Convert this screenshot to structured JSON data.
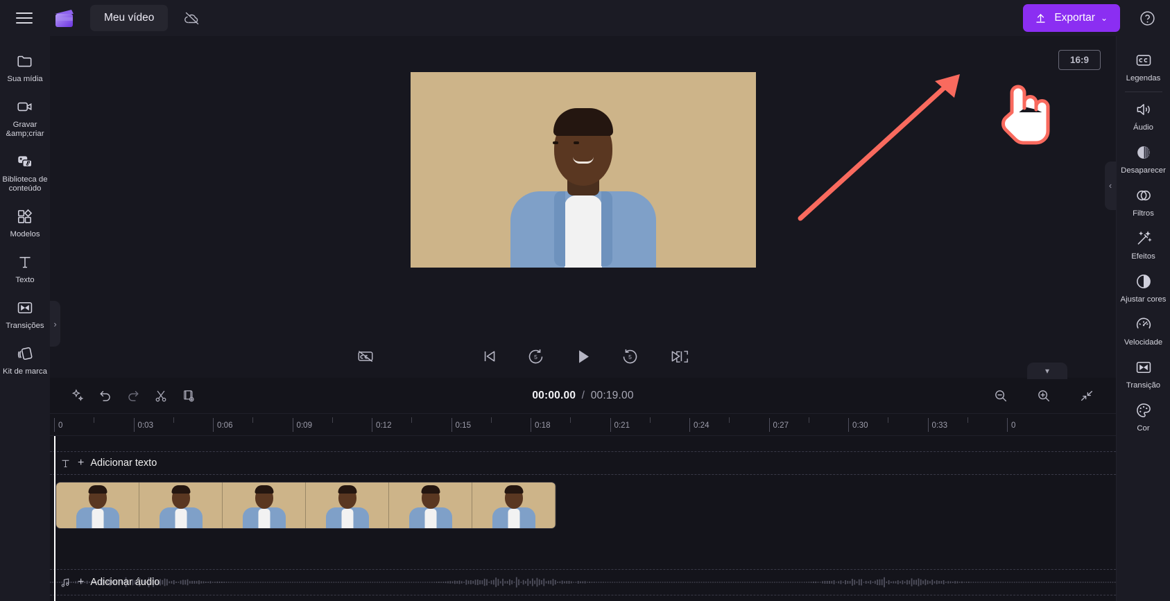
{
  "topbar": {
    "menu_icon": "hamburger-icon",
    "logo_icon": "clapperboard-logo",
    "project_name": "Meu vídeo",
    "cloud_status_icon": "cloud-off-icon",
    "export_label": "Exportar",
    "export_icon": "upload-icon",
    "export_caret": "⌄",
    "help_icon": "help-circle-icon",
    "accent_color": "#8b2ef2"
  },
  "left_rail": {
    "items": [
      {
        "label": "Sua mídia",
        "icon": "folder-icon"
      },
      {
        "label": "Gravar &amp;criar",
        "icon": "video-camera-icon"
      },
      {
        "label": "Biblioteca de conteúdo",
        "icon": "content-library-icon"
      },
      {
        "label": "Modelos",
        "icon": "templates-icon"
      },
      {
        "label": "Texto",
        "icon": "text-t-icon"
      },
      {
        "label": "Transições",
        "icon": "transitions-icon"
      },
      {
        "label": "Kit de marca",
        "icon": "brand-kit-icon"
      }
    ]
  },
  "preview": {
    "aspect_ratio": "16:9",
    "collapse_left_icon": "chevron-right-icon",
    "collapse_right_icon": "chevron-left-icon"
  },
  "player": {
    "cc_icon": "captions-off-icon",
    "skip_start_icon": "skip-to-start-icon",
    "back5_icon": "rewind-5-icon",
    "back5_label": "5",
    "play_icon": "play-icon",
    "fwd5_icon": "forward-5-icon",
    "fwd5_label": "5",
    "skip_end_icon": "skip-to-end-icon",
    "fullscreen_icon": "fullscreen-icon"
  },
  "timeline": {
    "collapse_icon": "chevron-down-icon",
    "tools": [
      {
        "icon": "magic-wand-icon",
        "name": "auto-compose"
      },
      {
        "icon": "undo-icon",
        "name": "undo"
      },
      {
        "icon": "redo-icon",
        "name": "redo"
      },
      {
        "icon": "scissors-icon",
        "name": "split"
      },
      {
        "icon": "duplicate-icon",
        "name": "duplicate"
      }
    ],
    "current_time": "00:00.00",
    "separator": "/",
    "total_time": "00:19.00",
    "zoom_out_icon": "zoom-out-icon",
    "zoom_in_icon": "zoom-in-icon",
    "fit_icon": "fit-to-screen-icon",
    "ruler_ticks": [
      "0",
      "0:03",
      "0:06",
      "0:09",
      "0:12",
      "0:15",
      "0:18",
      "0:21",
      "0:24",
      "0:27",
      "0:30",
      "0:33",
      "0"
    ],
    "text_track": {
      "icon": "text-t-icon",
      "plus": "+",
      "label": "Adicionar texto"
    },
    "audio_track": {
      "icon": "music-note-icon",
      "plus": "+",
      "label": "Adicionar áudio"
    },
    "video_clip": {
      "name": "video-clip",
      "thumbnails": 6
    }
  },
  "right_rail": {
    "items": [
      {
        "label": "Legendas",
        "icon": "cc-icon"
      },
      {
        "label": "Áudio",
        "icon": "speaker-icon"
      },
      {
        "label": "Desaparecer",
        "icon": "fade-icon"
      },
      {
        "label": "Filtros",
        "icon": "filters-icon"
      },
      {
        "label": "Efeitos",
        "icon": "effects-wand-icon"
      },
      {
        "label": "Ajustar cores",
        "icon": "contrast-icon"
      },
      {
        "label": "Velocidade",
        "icon": "speedometer-icon"
      },
      {
        "label": "Transição",
        "icon": "transitions-icon"
      },
      {
        "label": "Cor",
        "icon": "palette-icon"
      }
    ]
  },
  "annotation": {
    "arrow_color": "#f96a5e",
    "cursor_icon": "pointing-hand-cursor"
  }
}
